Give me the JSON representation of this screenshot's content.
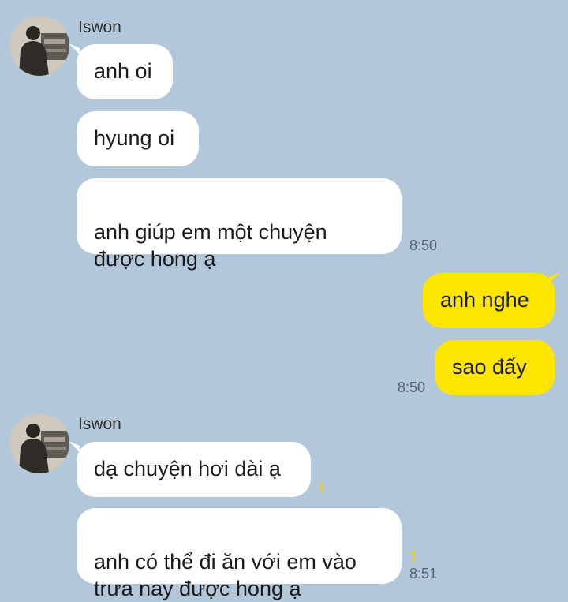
{
  "chat": {
    "sender_name": "Iswon",
    "group1": {
      "messages": [
        "anh oi",
        "hyung oi",
        "anh giúp em một chuyện\nđược hong ạ"
      ],
      "time": "8:50"
    },
    "mine": {
      "messages": [
        "anh nghe",
        "sao đấy"
      ],
      "time": "8:50"
    },
    "group2": {
      "messages": [
        "dạ chuyện hơi dài ạ",
        "anh có thể đi ăn với em vào\ntrưa nay được hong ạ"
      ],
      "unread": [
        "1",
        "1"
      ],
      "time": "8:51"
    }
  },
  "colors": {
    "background": "#b2c7da",
    "incoming_bubble": "#ffffff",
    "outgoing_bubble": "#fee500",
    "unread_count": "#f2cf00"
  }
}
